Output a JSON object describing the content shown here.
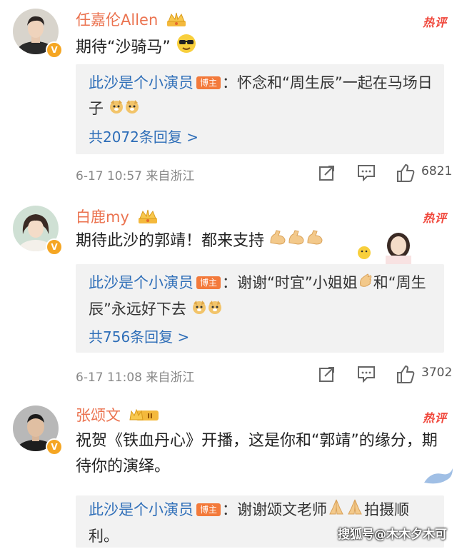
{
  "comments": [
    {
      "user": "任嘉伦Allen",
      "hot_label": "热评",
      "text": "期待“沙骑马”",
      "reply": {
        "author": "此沙是个小演员",
        "badge": "博主",
        "text": "：怀念和“周生辰”一起在马场日子",
        "count": "共2072条回复 >"
      },
      "time": "6-17 10:57",
      "location": "来自浙江",
      "likes": "6821"
    },
    {
      "user": "白鹿my",
      "hot_label": "热评",
      "text": "期待此沙的郭靖！都来支持",
      "reply": {
        "author": "此沙是个小演员",
        "badge": "博主",
        "text": "：谢谢“时宜”小姐姐",
        "text2": "和“周生辰”永远好下去",
        "count": "共756条回复 >"
      },
      "time": "6-17 11:08",
      "location": "来自浙江",
      "likes": "3702"
    },
    {
      "user": "张颂文",
      "hot_label": "热评",
      "text": "祝贺《铁血丹心》开播，这是你和“郭靖”的缘分，期待你的演绎。",
      "reply": {
        "author": "此沙是个小演员",
        "badge": "博主",
        "text": "：谢谢颂文老师",
        "text2": "拍摄顺利。"
      }
    }
  ],
  "watermark": "搜狐号@木木夕木可",
  "colors": {
    "username": "#eb7350",
    "link": "#2e6eb8",
    "hot": "#f0473b",
    "reply_bg": "#f2f2f2"
  }
}
